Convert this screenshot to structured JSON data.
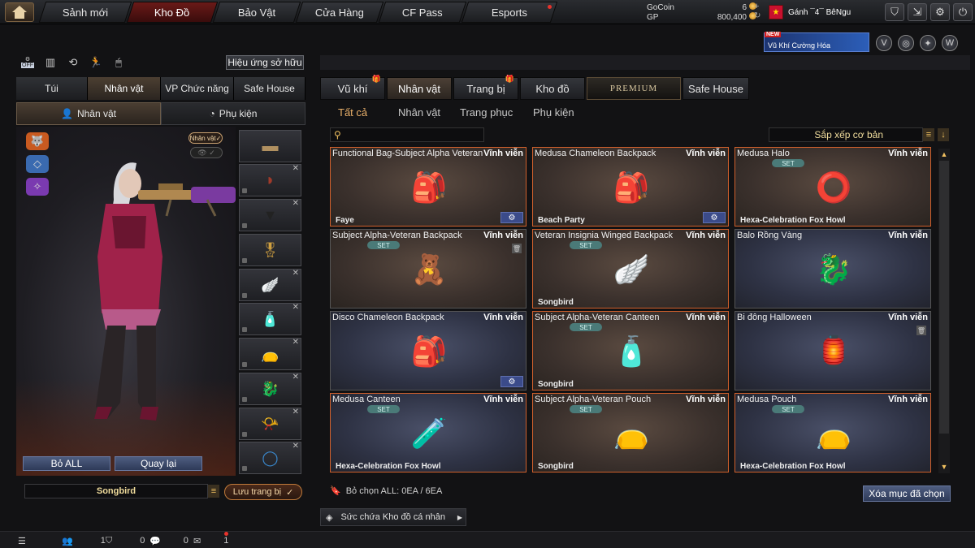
{
  "top_nav": {
    "tabs": [
      "Sảnh mới",
      "Kho Đồ",
      "Bảo Vật",
      "Cửa Hàng",
      "CF Pass",
      "Esports"
    ],
    "active": "Kho Đồ"
  },
  "currency": {
    "gocoin_label": "GoCoin",
    "gocoin_value": "6",
    "gp_label": "GP",
    "gp_value": "800,400"
  },
  "player": {
    "name": "Gánh ¯4¯ BêNgu",
    "flag_icon": "star-flag"
  },
  "promo": {
    "badge": "NEW",
    "text": "Vũ Khí Cường Hóa"
  },
  "left": {
    "effects_button": "Hiệu ứng sở hữu",
    "off_label": "OFF",
    "tabs": [
      "Túi",
      "Nhân vật",
      "VP Chức năng",
      "Safe House"
    ],
    "sub_tabs": [
      "Nhân vật",
      "Phụ kiện"
    ],
    "badge": "Nhân vật",
    "buttons": {
      "remove_all": "Bỏ ALL",
      "back": "Quay lại"
    },
    "character_name": "Songbird",
    "save_button": "Lưu trang bị"
  },
  "right": {
    "tabs": [
      "Vũ khí",
      "Nhân vật",
      "Trang bị",
      "Kho đồ",
      "PREMIUM",
      "Safe House"
    ],
    "categories": [
      "Tất cả",
      "Nhân vật",
      "Trang phục",
      "Phụ kiện"
    ],
    "search_placeholder": "",
    "sort_label": "Sắp xếp cơ bản",
    "items": [
      {
        "title": "Functional Bag-Subject Alpha Veteran",
        "perm": "Vĩnh viễn",
        "footer": "Faye",
        "set": false,
        "gear": true,
        "trash": false,
        "art": "🎒",
        "bg": "brown",
        "border": "orange"
      },
      {
        "title": "Medusa Chameleon Backpack",
        "perm": "Vĩnh viễn",
        "footer": "Beach Party",
        "set": false,
        "gear": true,
        "trash": false,
        "art": "🎒",
        "bg": "brown",
        "border": "orange"
      },
      {
        "title": "Medusa Halo",
        "perm": "Vĩnh viễn",
        "footer": "Hexa-Celebration Fox Howl",
        "set": true,
        "gear": false,
        "trash": false,
        "art": "⭕",
        "bg": "brown",
        "border": "orange"
      },
      {
        "title": "Subject Alpha-Veteran Backpack",
        "perm": "Vĩnh viễn",
        "footer": "",
        "set": true,
        "gear": false,
        "trash": true,
        "art": "🧸",
        "bg": "brown",
        "border": "none"
      },
      {
        "title": "Veteran Insignia Winged Backpack",
        "perm": "Vĩnh viễn",
        "footer": "Songbird",
        "set": true,
        "gear": false,
        "trash": false,
        "art": "🪽",
        "bg": "brown",
        "border": "orange"
      },
      {
        "title": "Balo Rồng Vàng",
        "perm": "Vĩnh viễn",
        "footer": "",
        "set": false,
        "gear": false,
        "trash": false,
        "art": "🐉",
        "bg": "blue",
        "border": "none"
      },
      {
        "title": "Disco Chameleon Backpack",
        "perm": "Vĩnh viễn",
        "footer": "",
        "set": false,
        "gear": true,
        "trash": false,
        "art": "🎒",
        "bg": "blue",
        "border": "none"
      },
      {
        "title": "Subject Alpha-Veteran Canteen",
        "perm": "Vĩnh viễn",
        "footer": "Songbird",
        "set": true,
        "gear": false,
        "trash": false,
        "art": "🧴",
        "bg": "brown",
        "border": "orange"
      },
      {
        "title": "Bi đông Halloween",
        "perm": "Vĩnh viễn",
        "footer": "",
        "set": false,
        "gear": false,
        "trash": true,
        "art": "🏮",
        "bg": "blue",
        "border": "none"
      },
      {
        "title": "Medusa Canteen",
        "perm": "Vĩnh viễn",
        "footer": "Hexa-Celebration Fox Howl",
        "set": true,
        "gear": false,
        "trash": false,
        "art": "🧪",
        "bg": "blue",
        "border": "orange"
      },
      {
        "title": "Subject Alpha-Veteran Pouch",
        "perm": "Vĩnh viễn",
        "footer": "Songbird",
        "set": true,
        "gear": false,
        "trash": false,
        "art": "👝",
        "bg": "brown",
        "border": "orange"
      },
      {
        "title": "Medusa Pouch",
        "perm": "Vĩnh viễn",
        "footer": "Hexa-Celebration Fox Howl",
        "set": true,
        "gear": false,
        "trash": false,
        "art": "👝",
        "bg": "blue",
        "border": "orange"
      }
    ],
    "set_label": "SET",
    "selected_text": "Bỏ chọn ALL: 0EA / 6EA",
    "delete_selected": "Xóa mục đã chọn",
    "capacity": "Sức chứa Kho đồ cá nhân"
  },
  "bottom_bar": {
    "counts": [
      "1",
      "0",
      "0",
      "1"
    ]
  }
}
